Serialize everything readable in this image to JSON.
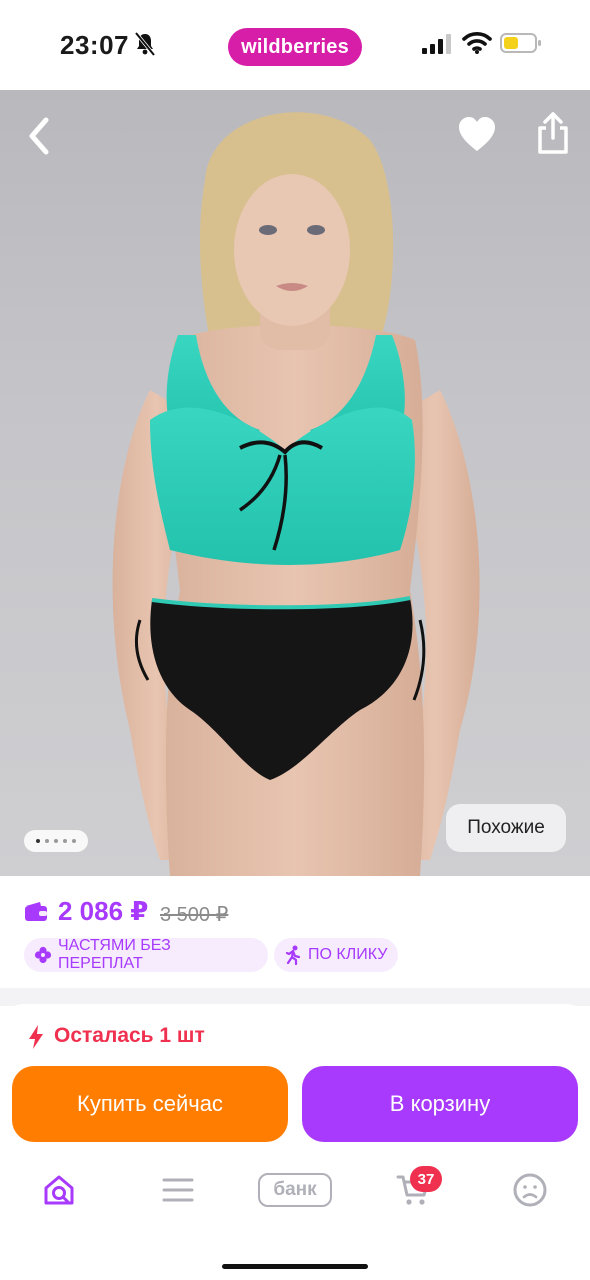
{
  "status_bar": {
    "time": "23:07",
    "brand": "wildberries",
    "icons": [
      "bell-muted-icon",
      "signal-icon",
      "wifi-icon",
      "battery-low-icon"
    ]
  },
  "product": {
    "photo_alt": "product-photo",
    "similar_label": "Похожие",
    "gallery_total": 5,
    "gallery_active": 1
  },
  "price": {
    "current": "2 086 ₽",
    "old": "3 500 ₽"
  },
  "badges": [
    {
      "label": "ЧАСТЯМИ БЕЗ ПЕРЕПЛАТ",
      "icon": "installments-icon"
    },
    {
      "label": "ПО КЛИКУ",
      "icon": "running-person-icon"
    }
  ],
  "stock": {
    "label": "Осталась 1 шт"
  },
  "actions": {
    "buy_now": "Купить сейчас",
    "add_to_cart": "В корзину"
  },
  "tabbar": {
    "bank_label": "банк",
    "cart_count": "37"
  },
  "colors": {
    "brand_pink": "#d71ea8",
    "accent_purple": "#a73afd",
    "buy_orange": "#ff7d00",
    "alert_red": "#f0304f"
  }
}
